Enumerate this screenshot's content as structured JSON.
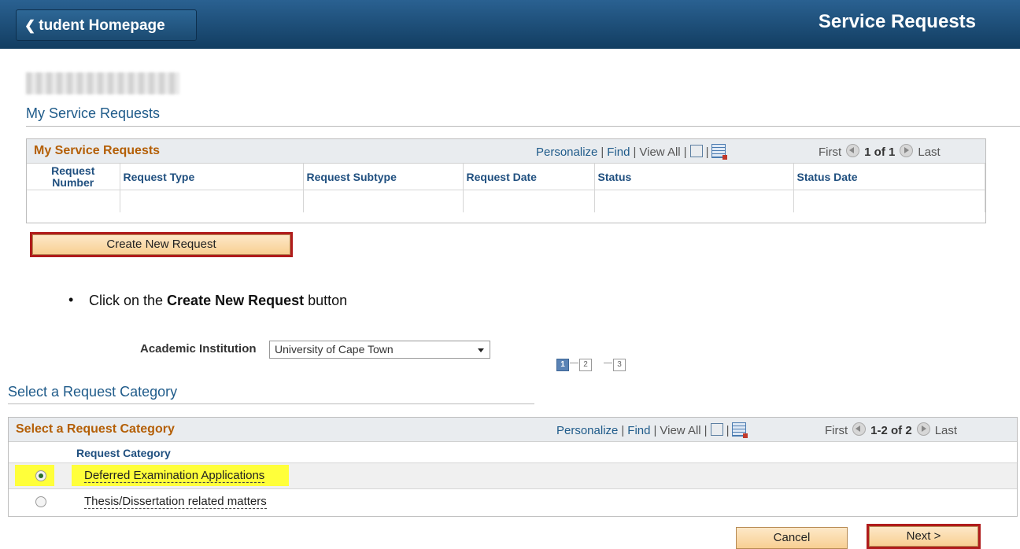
{
  "header": {
    "home_label": "tudent Homepage",
    "title": "Service Requests"
  },
  "page": {
    "section_title": "My Service Requests"
  },
  "requests_grid": {
    "caption": "My Service Requests",
    "tools": {
      "personalize": "Personalize",
      "find": "Find",
      "view_all": "View All",
      "first": "First",
      "range": "1 of 1",
      "last": "Last"
    },
    "columns": [
      "Request Number",
      "Request Type",
      "Request Subtype",
      "Request Date",
      "Status",
      "Status Date"
    ]
  },
  "create_button": "Create New Request",
  "instruction": {
    "prefix": "Click on the ",
    "bold": "Create New Request",
    "suffix": " button"
  },
  "institution": {
    "label": "Academic Institution",
    "value": "University of Cape Town"
  },
  "steps": [
    "1",
    "2",
    "3"
  ],
  "category_section_title": "Select a Request Category",
  "category_grid": {
    "caption": "Select a Request Category",
    "tools": {
      "personalize": "Personalize",
      "find": "Find",
      "view_all": "View All",
      "first": "First",
      "range": "1-2 of 2",
      "last": "Last"
    },
    "column": "Request Category",
    "rows": [
      {
        "label": "Deferred Examination Applications",
        "selected": true
      },
      {
        "label": "Thesis/Dissertation related matters",
        "selected": false
      }
    ]
  },
  "buttons": {
    "cancel": "Cancel",
    "next": "Next >"
  },
  "colors": {
    "header": "#1d4c72",
    "caption": "#b45f06",
    "highlight": "#ffff3a",
    "frame": "#b01c1c"
  }
}
